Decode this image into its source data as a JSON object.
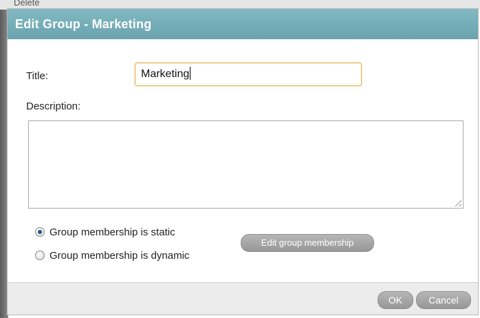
{
  "background": {
    "delete_label": "Delete"
  },
  "dialog": {
    "title": "Edit Group - Marketing",
    "title_label": "Title:",
    "title_value": "Marketing",
    "description_label": "Description:",
    "description_value": "",
    "membership": {
      "options": [
        {
          "label": "Group membership is static",
          "checked": true
        },
        {
          "label": "Group membership is dynamic",
          "checked": false
        }
      ],
      "edit_button_label": "Edit group membership"
    },
    "ok_label": "OK",
    "cancel_label": "Cancel"
  },
  "colors": {
    "titlebar": "#74adb7",
    "focus_border": "#e0b24a",
    "button_gray": "#a6a6a6"
  }
}
